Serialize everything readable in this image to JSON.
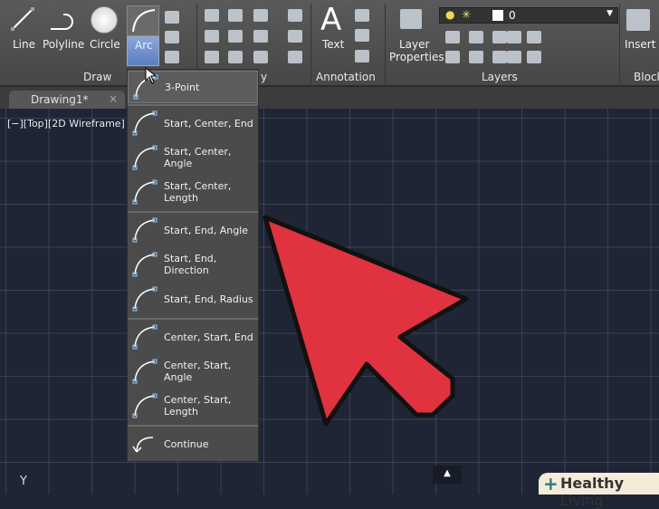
{
  "ribbon": {
    "draw": {
      "line": "Line",
      "polyline": "Polyline",
      "circle": "Circle",
      "arc": "Arc",
      "panel": "Draw"
    },
    "modify": {
      "panel": "y"
    },
    "annotation": {
      "text": "Text",
      "panel": "Annotation"
    },
    "layers": {
      "layer_properties_1": "Layer",
      "layer_properties_2": "Properties",
      "current_layer": "0",
      "panel": "Layers"
    },
    "block": {
      "insert": "Insert",
      "panel": "Block"
    }
  },
  "tab": {
    "title": "Drawing1*"
  },
  "viewport": {
    "label": "[−][Top][2D Wireframe]"
  },
  "arc_menu": {
    "items": [
      "3-Point",
      "Start, Center, End",
      "Start, Center, Angle",
      "Start, Center, Length",
      "Start, End, Angle",
      "Start, End, Direction",
      "Start, End, Radius",
      "Center, Start, End",
      "Center, Start, Angle",
      "Center, Start, Length",
      "Continue"
    ]
  },
  "ucs": {
    "axis": "Y"
  },
  "watermark": {
    "brand1": "Healthy",
    "brand2": "Living"
  },
  "colors": {
    "arrow": "#e0323f",
    "highlight": "#6b8fd0"
  }
}
